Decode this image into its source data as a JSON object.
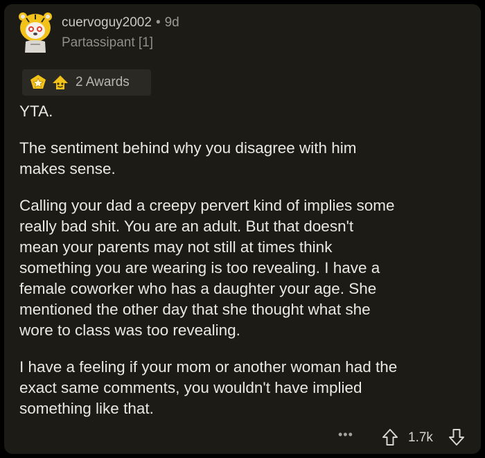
{
  "comment": {
    "username": "cuervoguy2002",
    "separator": "•",
    "age": "9d",
    "flair": "Partassipant [1]",
    "avatar_icon": "tiger-costume-avatar",
    "awards": {
      "icons": [
        "star-award-icon",
        "helpful-award-icon"
      ],
      "label": "2 Awards"
    },
    "paragraphs": [
      "YTA.",
      "The sentiment behind why you disagree with him\nmakes sense.",
      "Calling your dad a creepy pervert kind of implies some\nreally bad shit.   You are an adult.  But that doesn't\nmean your parents may not still at times think\nsomething you are wearing is too revealing.  I have a\nfemale coworker who has a daughter your age.   She\nmentioned the other day that she thought what she\nwore to class was too revealing.",
      "I have a feeling if your mom or another woman had the\nexact same comments, you wouldn't have implied\nsomething like that."
    ],
    "footer": {
      "more_label": "•••",
      "score": "1.7k"
    }
  },
  "colors": {
    "card_background": "#1c1b16",
    "page_background": "#000000",
    "text": "#e9e8e3",
    "muted_text": "#8f8e88",
    "avatar_accent": "#f2c21b"
  }
}
